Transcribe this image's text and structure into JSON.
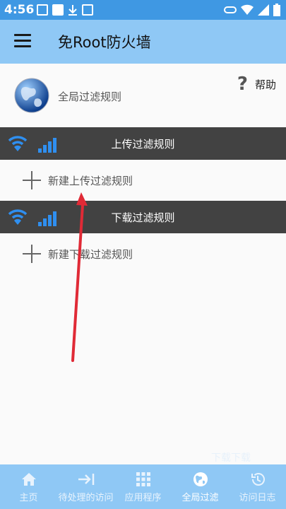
{
  "status_bar": {
    "time": "4:56"
  },
  "app_bar": {
    "title": "免Root防火墙"
  },
  "global": {
    "label": "全局过滤规则",
    "help_label": "帮助"
  },
  "upload": {
    "section_title": "上传过滤规则",
    "add_label": "新建上传过滤规则"
  },
  "download": {
    "section_title": "下载过滤规则",
    "add_label": "新建下载过滤规则"
  },
  "watermark": "下载下载",
  "bottom_nav": {
    "items": [
      {
        "label": "主页",
        "icon": "home-icon"
      },
      {
        "label": "待处理的访问",
        "icon": "arrow-right-icon"
      },
      {
        "label": "应用程序",
        "icon": "grid-icon"
      },
      {
        "label": "全局过滤",
        "icon": "globe-icon"
      },
      {
        "label": "访问日志",
        "icon": "history-icon"
      }
    ],
    "active_index": 3
  },
  "colors": {
    "app_bar": "#8fc8f5",
    "status_bar": "#3f98e3",
    "section_bar": "#424242",
    "accent_blue": "#2f8ff0",
    "arrow": "#e02a36"
  }
}
